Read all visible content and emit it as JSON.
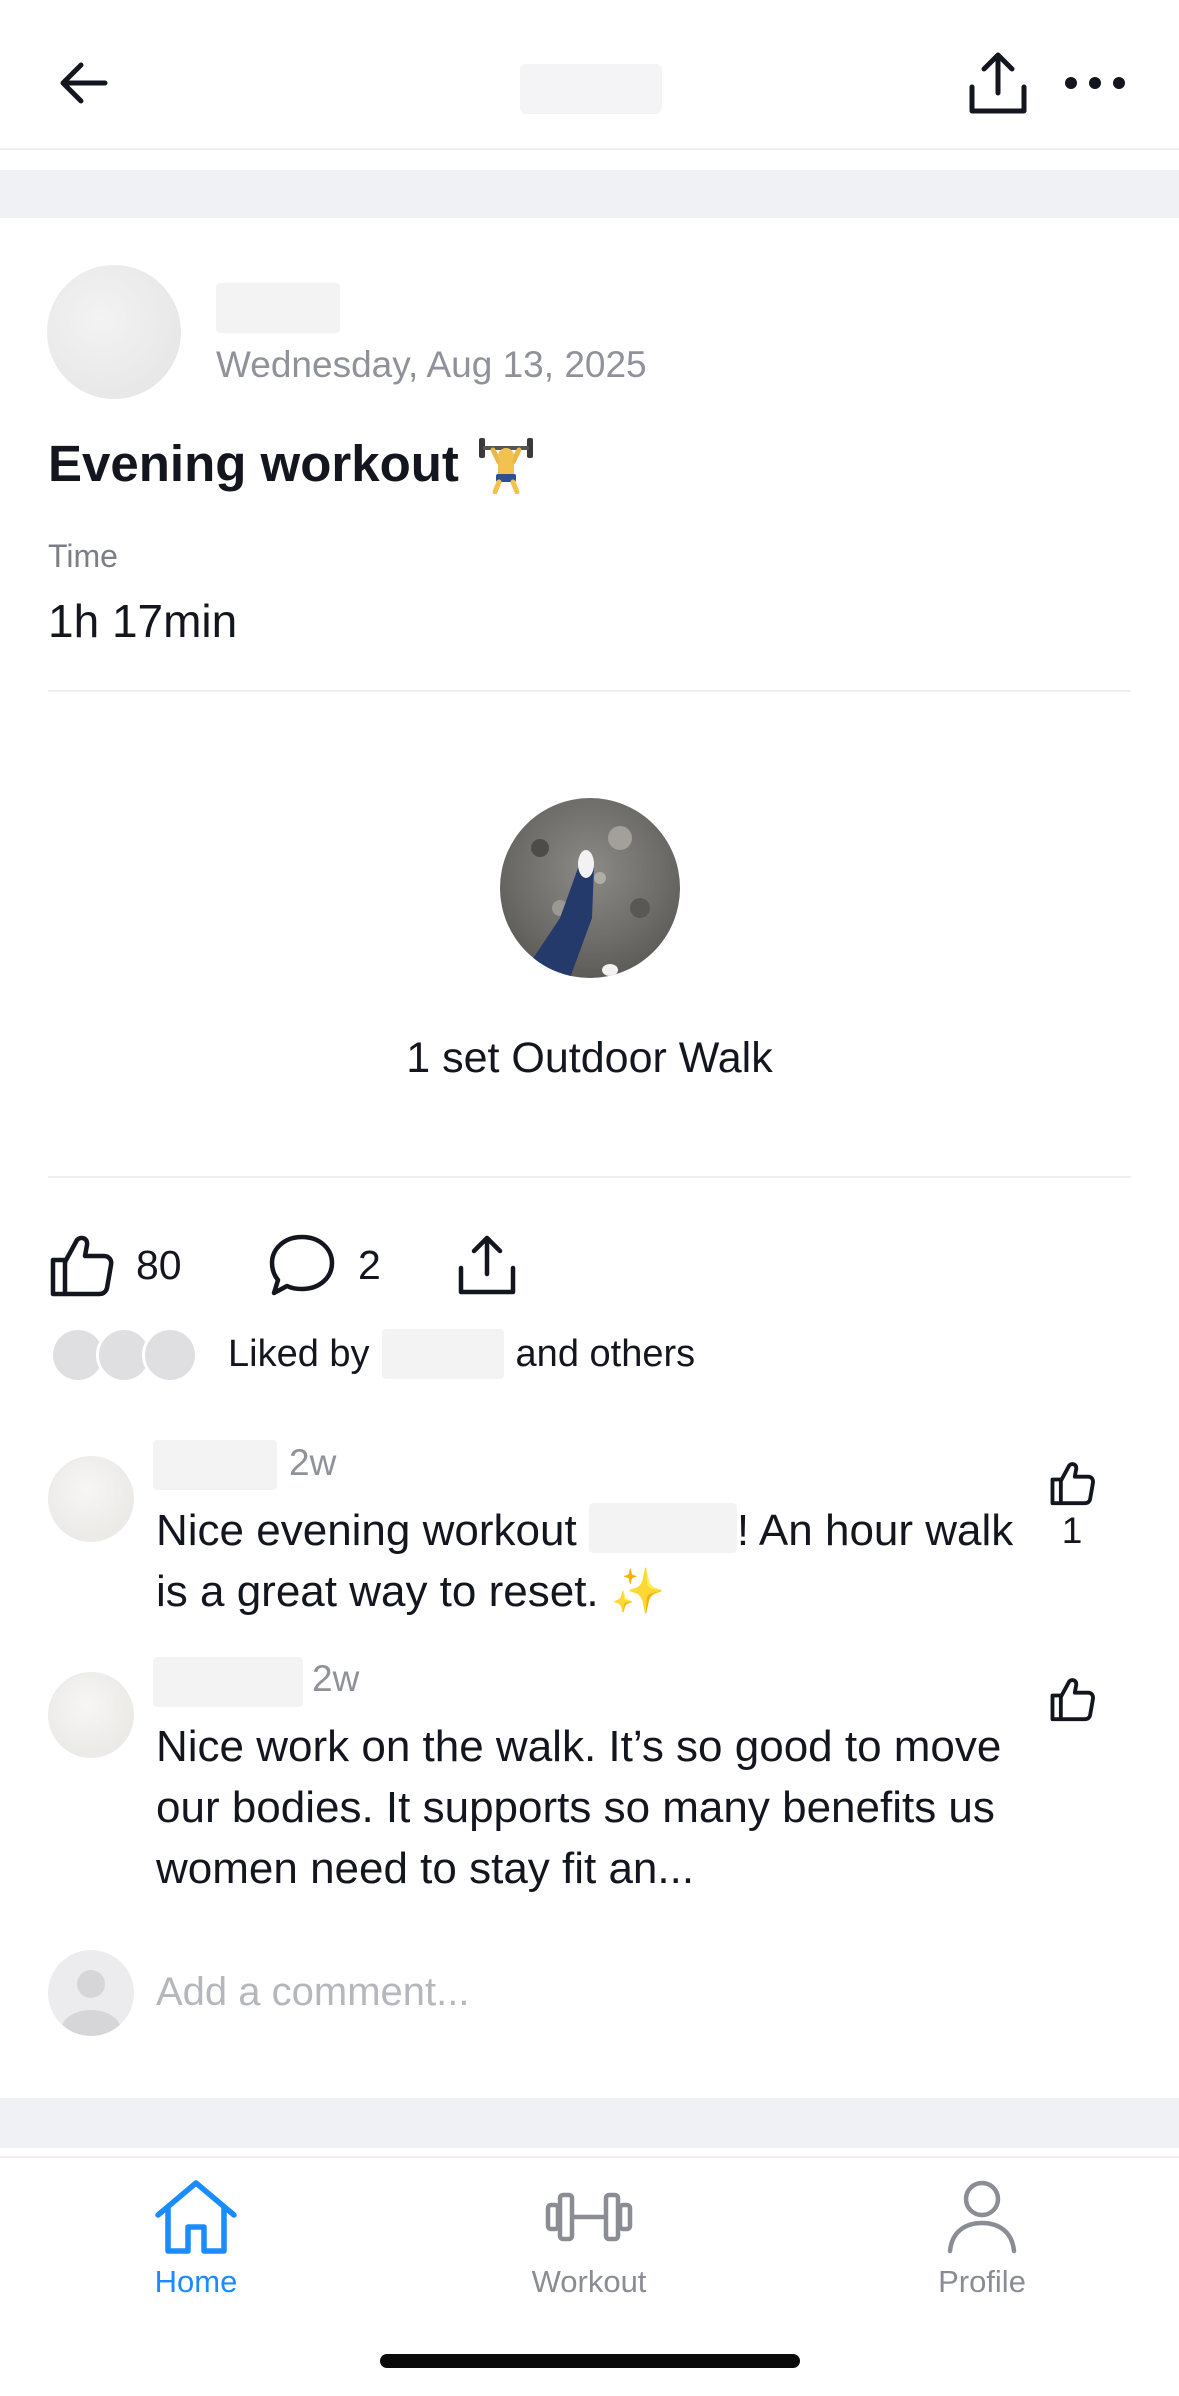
{
  "header": {
    "back_icon": "arrow-left-icon",
    "share_icon": "share-upload-icon",
    "more_icon": "ellipsis-horizontal-icon"
  },
  "post": {
    "date": "Wednesday, Aug 13, 2025",
    "title": "Evening workout",
    "title_icon": "weightlifter-emoji-icon",
    "time_label": "Time",
    "time_value": "1h 17min",
    "exercise_label": "1 set Outdoor Walk"
  },
  "actions": {
    "likes_count": "80",
    "comments_count": "2",
    "liked_by_prefix": "Liked by",
    "liked_by_suffix": "and others"
  },
  "comments": [
    {
      "time": "2w",
      "text_before": "Nice evening workout",
      "text_after": "! An hour walk is a great way to reset. ✨",
      "likes": "1"
    },
    {
      "time": "2w",
      "text": "Nice work on the walk. It’s so good to move our bodies. It supports so many benefits us women need to stay fit an...",
      "likes": ""
    }
  ],
  "add_comment": {
    "placeholder": "Add a comment..."
  },
  "tabbar": {
    "home": "Home",
    "workout": "Workout",
    "profile": "Profile",
    "active": "Home"
  },
  "colors": {
    "accent": "#1a8cff",
    "text": "#14161f",
    "muted": "#8f929a",
    "tab_inactive": "#8a8d94"
  }
}
